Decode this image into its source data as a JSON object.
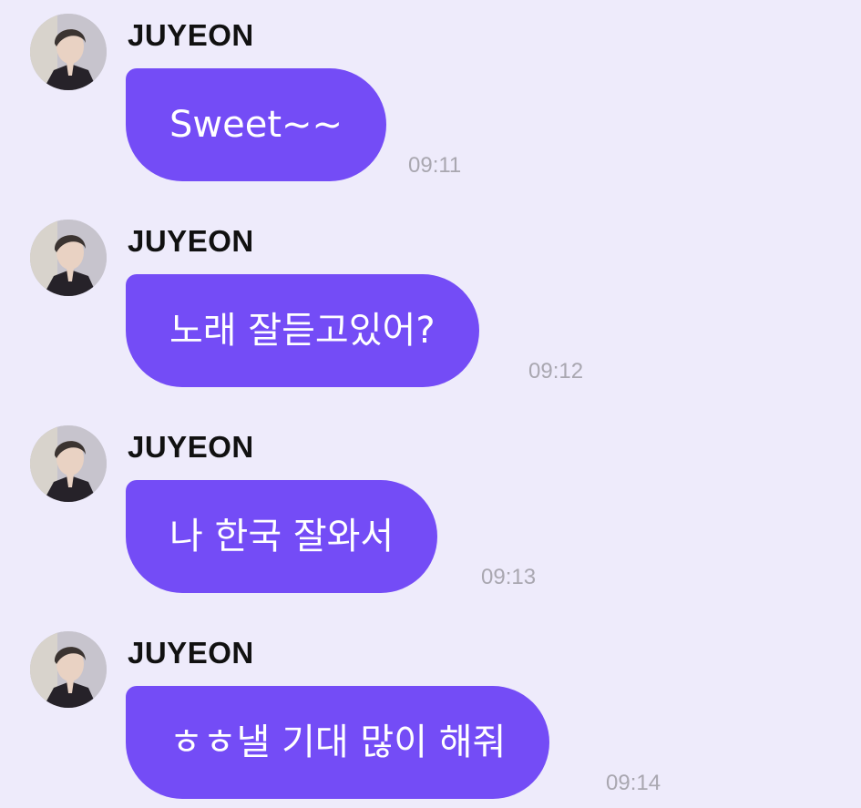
{
  "messages": [
    {
      "sender": "JUYEON",
      "text": "Sweet~~",
      "time": "09:11"
    },
    {
      "sender": "JUYEON",
      "text": "노래 잘듣고있어?",
      "time": "09:12"
    },
    {
      "sender": "JUYEON",
      "text": "나 한국 잘와서",
      "time": "09:13"
    },
    {
      "sender": "JUYEON",
      "text": "ㅎㅎ낼 기대 많이 해줘",
      "time": "09:14"
    }
  ],
  "colors": {
    "background": "#eeebfb",
    "bubble": "#744cf6",
    "bubble_text": "#ffffff",
    "sender": "#111111",
    "time": "#a9a7b0"
  },
  "icons": {
    "avatar": "profile-photo"
  }
}
